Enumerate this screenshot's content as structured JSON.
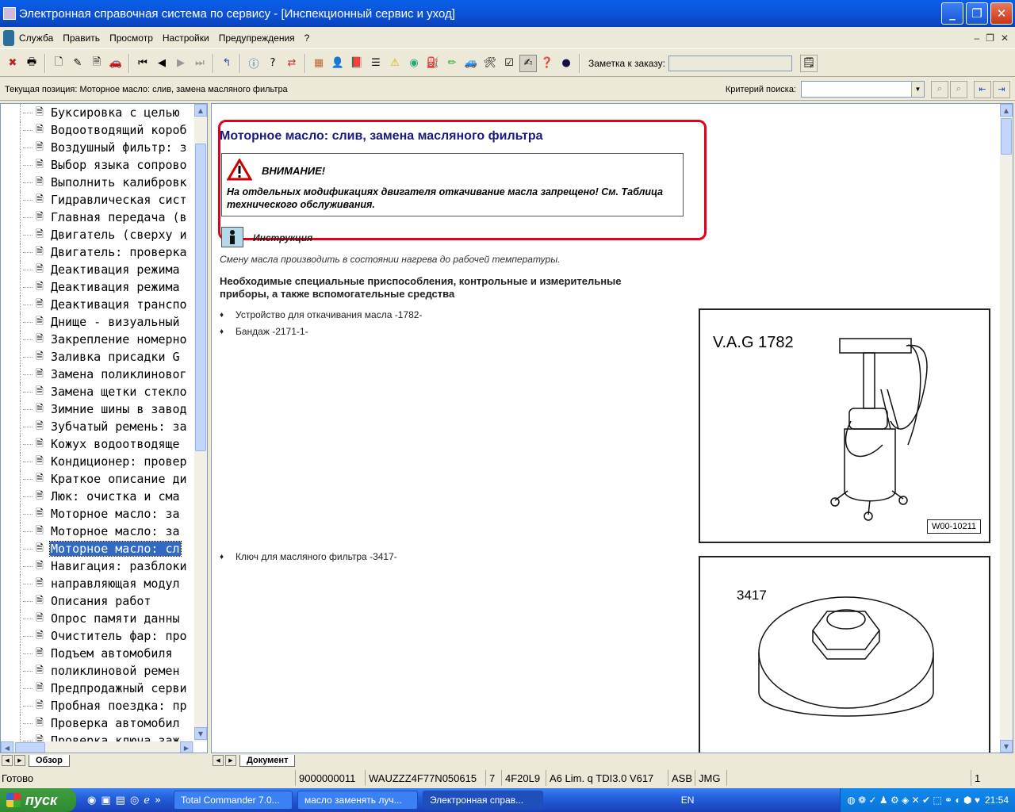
{
  "window": {
    "title": "Электронная справочная система по сервису - [Инспекционный сервис и уход]"
  },
  "menu": [
    "Служба",
    "Править",
    "Просмотр",
    "Настройки",
    "Предупреждения",
    "?"
  ],
  "toolbar": {
    "note_label": "Заметка к заказу:",
    "note_value": ""
  },
  "position": {
    "label": "Текущая позиция: Моторное масло: слив, замена масляного фильтра",
    "search_label": "Критерий поиска:",
    "search_value": ""
  },
  "tree": {
    "items": [
      "Буксировка с целью",
      "Водоотводящий короб",
      "Воздушный фильтр: з",
      "Выбор языка сопрово",
      "Выполнить калибровк",
      "Гидравлическая сист",
      "Главная передача (в",
      "Двигатель (сверху и",
      "Двигатель: проверка",
      "Деактивация режима",
      "Деактивация режима",
      "Деактивация транспо",
      "Днище - визуальный",
      "Закрепление номерно",
      "Заливка присадки G",
      "Замена поликлиновог",
      "Замена щетки стекло",
      "Зимние шины в завод",
      "Зубчатый ремень: за",
      "Кожух водоотводяще",
      "Кондиционер: провер",
      "Краткое описание ди",
      "Люк: очистка и сма",
      "Моторное масло: за",
      "Моторное масло: за",
      "Моторное масло: сл",
      "Навигация: разблоки",
      "направляющая модул",
      "Описания работ",
      "Опрос памяти данны",
      "Очиститель фар: про",
      "Подъем автомобиля",
      "поликлиновой ремен",
      "Предпродажный серви",
      "Пробная поездка: пр",
      "Проверка автомобил",
      "Проверка ключа заж"
    ],
    "selected_index": 25,
    "tab_label": "Обзор"
  },
  "document": {
    "title": "Моторное масло: слив, замена масляного фильтра",
    "warning_heading": "ВНИМАНИЕ!",
    "warning_text": "На отдельных модификациях двигателя откачивание масла запрещено! См. Таблица технического обслуживания.",
    "instruction_label": "Инструкция",
    "note": "Смену масла производить в состоянии нагрева до рабочей температуры.",
    "tools_heading": "Необходимые специальные приспособления, контрольные и измерительные приборы, а также вспомогательные средства",
    "bullets": [
      "Устройство для откачивания масла -1782-",
      "Бандаж -2171-1-",
      "Ключ для масляного фильтра -3417-"
    ],
    "figure1": {
      "label": "V.A.G 1782",
      "code": "W00-10211"
    },
    "figure2": {
      "label": "3417"
    },
    "tab_label": "Документ"
  },
  "status": {
    "ready": "Готово",
    "fields": [
      "9000000011",
      "WAUZZZ4F77N050615",
      "7",
      "4F20L9",
      "A6 Lim. q TDI3.0 V617",
      "ASB",
      "JMG",
      "",
      "1"
    ]
  },
  "taskbar": {
    "start": "пуск",
    "tasks": [
      "Total Commander 7.0...",
      "масло заменять луч...",
      "Электронная справ..."
    ],
    "lang": "EN",
    "clock": "21:54"
  }
}
